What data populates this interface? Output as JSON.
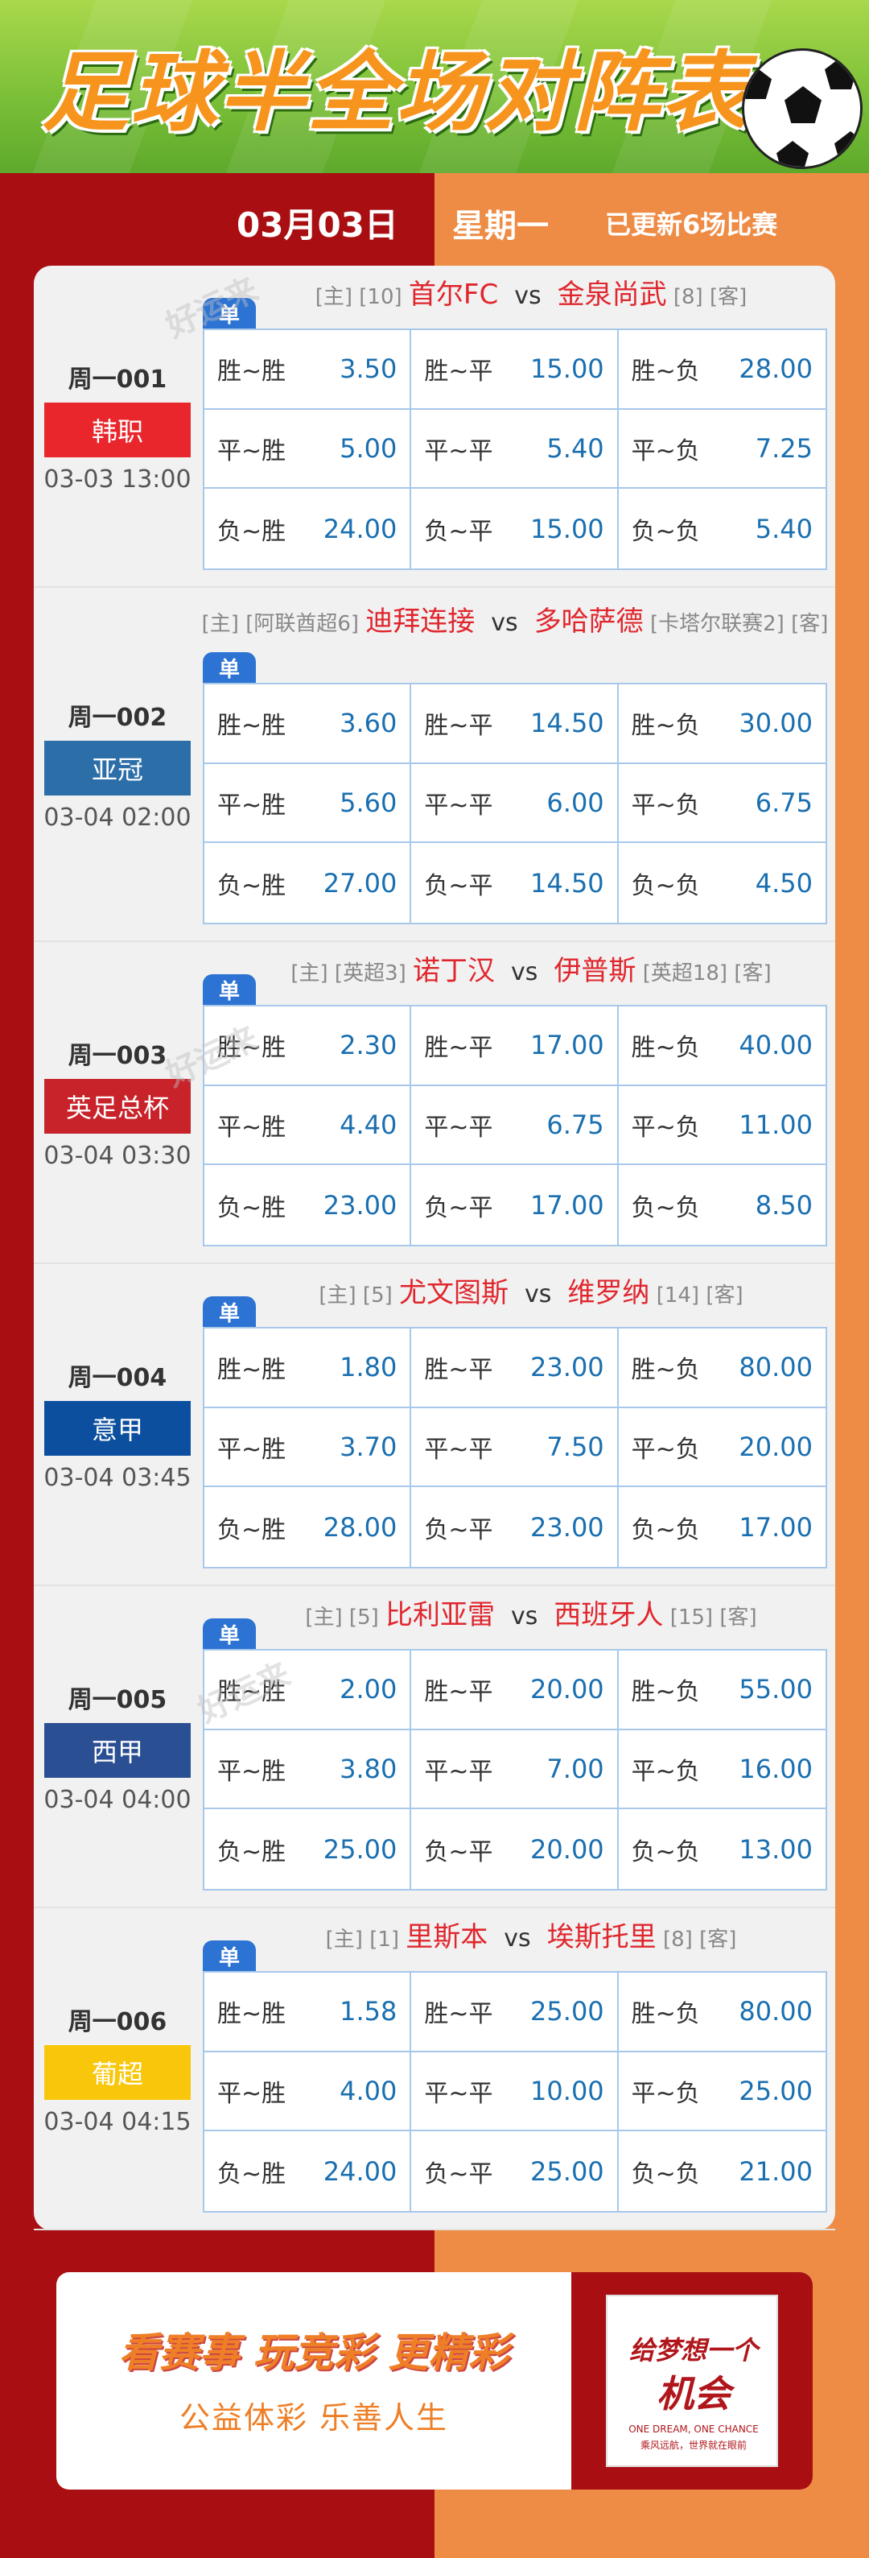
{
  "header": {
    "title": "足球半全场对阵表"
  },
  "date_bar": {
    "date": "03月03日",
    "weekday": "星期一",
    "updated": "已更新6场比赛"
  },
  "watermark": "好运来",
  "single_badge": "单",
  "matches": [
    {
      "num": "周一001",
      "league": "韩职",
      "league_color": "#e8262b",
      "time": "03-03 13:00",
      "home_tag": "[主]",
      "home_rank": "[10]",
      "home": "首尔FC",
      "vs": "vs",
      "away": "金泉尚武",
      "away_rank": "[8]",
      "away_tag": "[客]",
      "odds": [
        {
          "label": "胜~胜",
          "value": "3.50"
        },
        {
          "label": "胜~平",
          "value": "15.00"
        },
        {
          "label": "胜~负",
          "value": "28.00"
        },
        {
          "label": "平~胜",
          "value": "5.00"
        },
        {
          "label": "平~平",
          "value": "5.40"
        },
        {
          "label": "平~负",
          "value": "7.25"
        },
        {
          "label": "负~胜",
          "value": "24.00"
        },
        {
          "label": "负~平",
          "value": "15.00"
        },
        {
          "label": "负~负",
          "value": "5.40"
        }
      ]
    },
    {
      "num": "周一002",
      "league": "亚冠",
      "league_color": "#2c6ea8",
      "time": "03-04 02:00",
      "home_tag": "[主]",
      "home_rank": "[阿联酋超6]",
      "home": "迪拜连接",
      "vs": "vs",
      "away": "多哈萨德",
      "away_rank": "[卡塔尔联赛2]",
      "away_tag": "[客]",
      "odds": [
        {
          "label": "胜~胜",
          "value": "3.60"
        },
        {
          "label": "胜~平",
          "value": "14.50"
        },
        {
          "label": "胜~负",
          "value": "30.00"
        },
        {
          "label": "平~胜",
          "value": "5.60"
        },
        {
          "label": "平~平",
          "value": "6.00"
        },
        {
          "label": "平~负",
          "value": "6.75"
        },
        {
          "label": "负~胜",
          "value": "27.00"
        },
        {
          "label": "负~平",
          "value": "14.50"
        },
        {
          "label": "负~负",
          "value": "4.50"
        }
      ]
    },
    {
      "num": "周一003",
      "league": "英足总杯",
      "league_color": "#c8232b",
      "time": "03-04 03:30",
      "home_tag": "[主]",
      "home_rank": "[英超3]",
      "home": "诺丁汉",
      "vs": "vs",
      "away": "伊普斯",
      "away_rank": "[英超18]",
      "away_tag": "[客]",
      "odds": [
        {
          "label": "胜~胜",
          "value": "2.30"
        },
        {
          "label": "胜~平",
          "value": "17.00"
        },
        {
          "label": "胜~负",
          "value": "40.00"
        },
        {
          "label": "平~胜",
          "value": "4.40"
        },
        {
          "label": "平~平",
          "value": "6.75"
        },
        {
          "label": "平~负",
          "value": "11.00"
        },
        {
          "label": "负~胜",
          "value": "23.00"
        },
        {
          "label": "负~平",
          "value": "17.00"
        },
        {
          "label": "负~负",
          "value": "8.50"
        }
      ]
    },
    {
      "num": "周一004",
      "league": "意甲",
      "league_color": "#0c4f9e",
      "time": "03-04 03:45",
      "home_tag": "[主]",
      "home_rank": "[5]",
      "home": "尤文图斯",
      "vs": "vs",
      "away": "维罗纳",
      "away_rank": "[14]",
      "away_tag": "[客]",
      "odds": [
        {
          "label": "胜~胜",
          "value": "1.80"
        },
        {
          "label": "胜~平",
          "value": "23.00"
        },
        {
          "label": "胜~负",
          "value": "80.00"
        },
        {
          "label": "平~胜",
          "value": "3.70"
        },
        {
          "label": "平~平",
          "value": "7.50"
        },
        {
          "label": "平~负",
          "value": "20.00"
        },
        {
          "label": "负~胜",
          "value": "28.00"
        },
        {
          "label": "负~平",
          "value": "23.00"
        },
        {
          "label": "负~负",
          "value": "17.00"
        }
      ]
    },
    {
      "num": "周一005",
      "league": "西甲",
      "league_color": "#2a4f92",
      "time": "03-04 04:00",
      "home_tag": "[主]",
      "home_rank": "[5]",
      "home": "比利亚雷",
      "vs": "vs",
      "away": "西班牙人",
      "away_rank": "[15]",
      "away_tag": "[客]",
      "odds": [
        {
          "label": "胜~胜",
          "value": "2.00"
        },
        {
          "label": "胜~平",
          "value": "20.00"
        },
        {
          "label": "胜~负",
          "value": "55.00"
        },
        {
          "label": "平~胜",
          "value": "3.80"
        },
        {
          "label": "平~平",
          "value": "7.00"
        },
        {
          "label": "平~负",
          "value": "16.00"
        },
        {
          "label": "负~胜",
          "value": "25.00"
        },
        {
          "label": "负~平",
          "value": "20.00"
        },
        {
          "label": "负~负",
          "value": "13.00"
        }
      ]
    },
    {
      "num": "周一006",
      "league": "葡超",
      "league_color": "#f8c70c",
      "time": "03-04 04:15",
      "home_tag": "[主]",
      "home_rank": "[1]",
      "home": "里斯本",
      "vs": "vs",
      "away": "埃斯托里",
      "away_rank": "[8]",
      "away_tag": "[客]",
      "odds": [
        {
          "label": "胜~胜",
          "value": "1.58"
        },
        {
          "label": "胜~平",
          "value": "25.00"
        },
        {
          "label": "胜~负",
          "value": "80.00"
        },
        {
          "label": "平~胜",
          "value": "4.00"
        },
        {
          "label": "平~平",
          "value": "10.00"
        },
        {
          "label": "平~负",
          "value": "25.00"
        },
        {
          "label": "负~胜",
          "value": "24.00"
        },
        {
          "label": "负~平",
          "value": "25.00"
        },
        {
          "label": "负~负",
          "value": "21.00"
        }
      ]
    }
  ],
  "footer": {
    "slogan": "看赛事 玩竞彩 更精彩",
    "slogan2": "公益体彩 乐善人生",
    "logo_line1": "给梦想一个",
    "logo_line2": "机会",
    "logo_en": "ONE DREAM, ONE CHANCE",
    "logo_cn_small": "乘风远航，世界就在眼前"
  }
}
